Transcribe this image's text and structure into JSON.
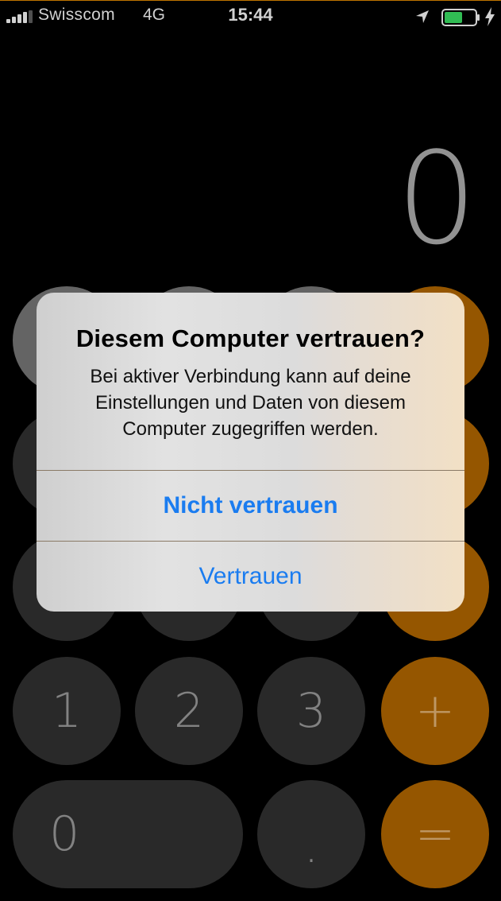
{
  "status_bar": {
    "carrier": "Swisscom",
    "network": "4G",
    "time": "15:44",
    "icons": [
      "signal-icon",
      "location-icon",
      "battery-icon",
      "charging-bolt-icon"
    ],
    "battery_color": "#34c759"
  },
  "calculator": {
    "display_value": "0",
    "keys": {
      "one": "1",
      "two": "2",
      "three": "3",
      "plus": "+",
      "zero": "0",
      "decimal": ".",
      "equals": "="
    },
    "colors": {
      "operator": "#9d5b00",
      "digit": "#2c2c2c",
      "function": "#6a6a6a"
    }
  },
  "alert": {
    "title": "Diesem Computer vertrauen?",
    "message": "Bei aktiver Verbindung kann auf deine Einstellungen und Daten von diesem Computer zugegriffen werden.",
    "buttons": {
      "dont_trust": "Nicht vertrauen",
      "trust": "Vertrauen"
    },
    "button_color": "#1a7cf0"
  }
}
